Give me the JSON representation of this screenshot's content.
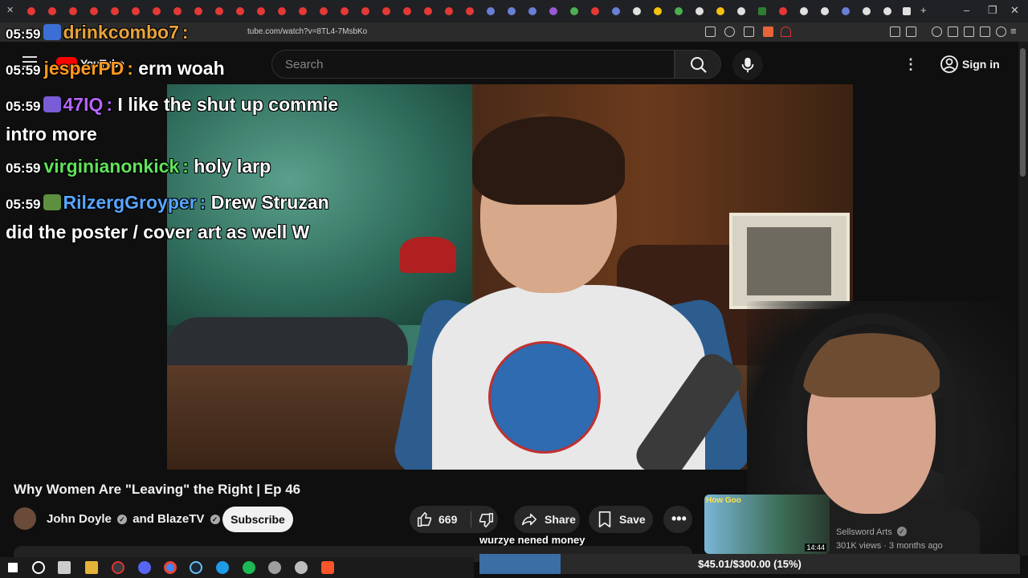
{
  "browser": {
    "url": "tube.com/watch?v=8TL4-7MsbKo"
  },
  "youtube": {
    "logo_text": "YouTube",
    "search_placeholder": "Search",
    "sign_in": "Sign in"
  },
  "chat": [
    {
      "time": "05:59",
      "user": "drinkcombo7",
      "user_color": "#e8a33a",
      "message": "",
      "badge": "#3b6fd6"
    },
    {
      "time": "05:59",
      "user": "jesperPD",
      "user_color": "#ff9a1f",
      "message": "erm woah",
      "badge": ""
    },
    {
      "time": "05:59",
      "user": "47IQ",
      "user_color": "#b565ff",
      "message": "I like the shut up commie intro more",
      "badge": "#7a5cd6"
    },
    {
      "time": "05:59",
      "user": "virginianonkick",
      "user_color": "#5fe35a",
      "message": "holy larp",
      "badge": ""
    },
    {
      "time": "05:59",
      "user": "RilzergGroyper",
      "user_color": "#58a6ff",
      "message": "Drew Struzan did the poster / cover art as well W",
      "badge": "#5e8f3e"
    }
  ],
  "video": {
    "title": "Why Women Are \"Leaving\" the Right | Ep 46",
    "channel_1": "John Doyle",
    "channel_connector": "and",
    "channel_2": "BlazeTV",
    "subscribe_label": "Subscribe",
    "like_count": "669",
    "share_label": "Share",
    "save_label": "Save"
  },
  "recommended": {
    "thumb_label": "How Goo",
    "duration": "14:44",
    "channel": "Sellsword Arts",
    "meta": "301K views · 3 months ago"
  },
  "donation_goal": {
    "text": "wurzye nened money",
    "label": "$45.01/$300.00 (15%)",
    "progress": 0.15,
    "fill_color": "#3b6ea5"
  },
  "icons": [
    "hamburger-icon",
    "search-icon",
    "mic-icon",
    "more-vert-icon",
    "account-icon",
    "verified-icon",
    "like-icon",
    "dislike-icon",
    "share-icon",
    "save-icon",
    "more-horiz-icon"
  ]
}
